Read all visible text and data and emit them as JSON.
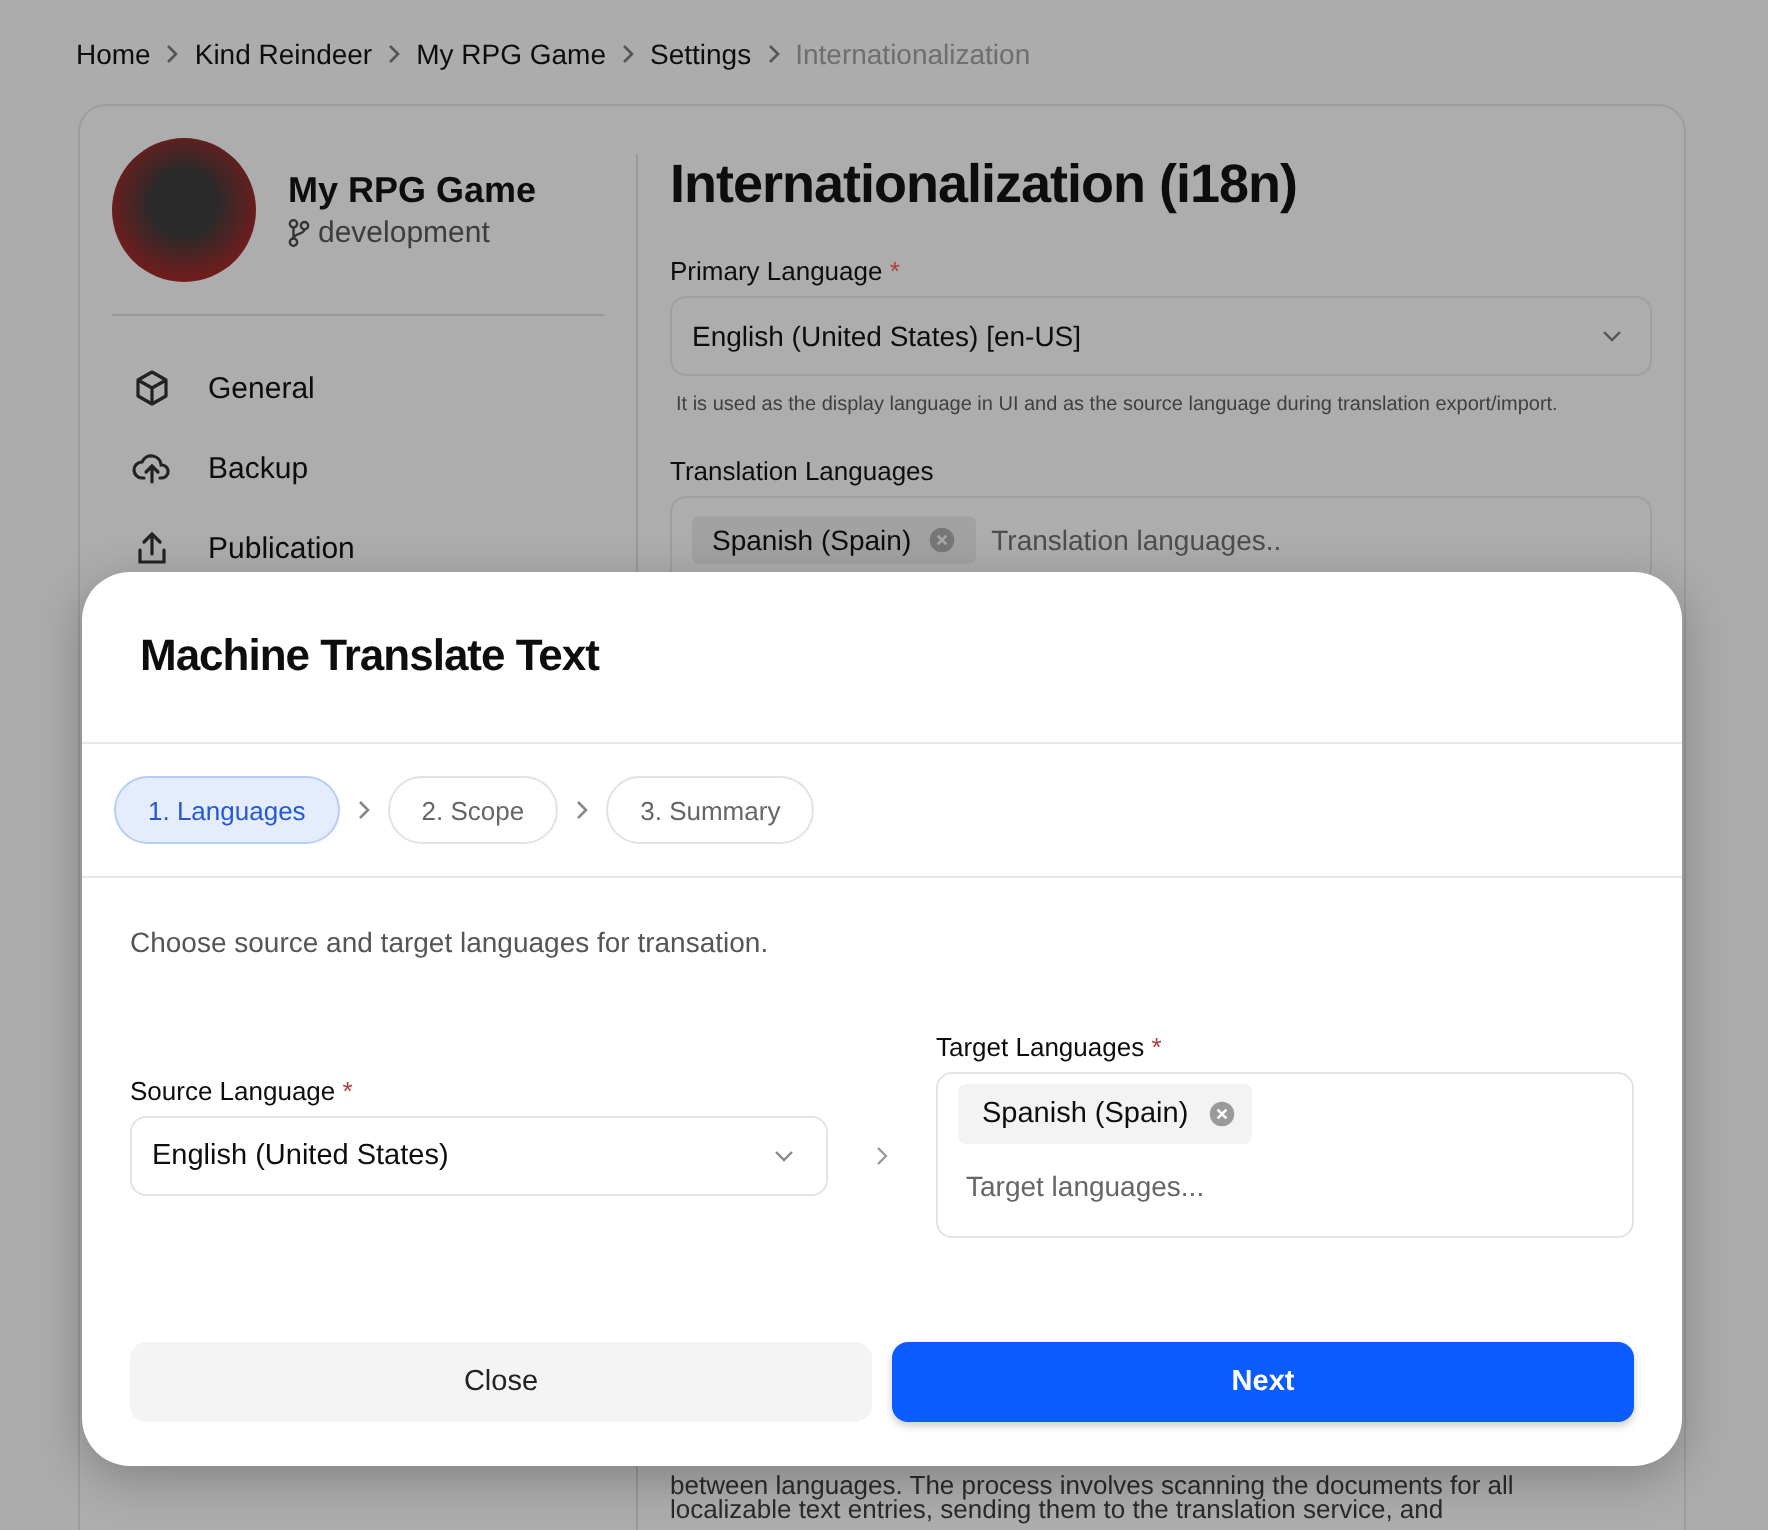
{
  "breadcrumb": [
    {
      "label": "Home",
      "current": false
    },
    {
      "label": "Kind Reindeer",
      "current": false
    },
    {
      "label": "My RPG Game",
      "current": false
    },
    {
      "label": "Settings",
      "current": false
    },
    {
      "label": "Internationalization",
      "current": true
    }
  ],
  "project": {
    "name": "My RPG Game",
    "branch": "development"
  },
  "nav": [
    {
      "label": "General",
      "kind": "cube"
    },
    {
      "label": "Backup",
      "kind": "upload"
    },
    {
      "label": "Publication",
      "kind": "share"
    }
  ],
  "page": {
    "title": "Internationalization (i18n)",
    "primary_language": {
      "label": "Primary Language",
      "required_mark": "*",
      "value": "English (United States) [en-US]",
      "hint": "It is used as the display language in UI and as the source language during translation export/import."
    },
    "translation_languages": {
      "label": "Translation Languages",
      "tags": [
        "Spanish (Spain)"
      ],
      "placeholder": "Translation languages.."
    },
    "description_lines": [
      "between languages. The process involves scanning the documents for all",
      "localizable text entries, sending them to the translation service, and"
    ]
  },
  "dialog": {
    "title": "Machine Translate Text",
    "steps": [
      {
        "label": "1. Languages",
        "selected": true
      },
      {
        "label": "2. Scope",
        "selected": false
      },
      {
        "label": "3. Summary",
        "selected": false
      }
    ],
    "instruction": "Choose source and target languages for transation.",
    "source": {
      "label": "Source Language",
      "required_mark": "*",
      "value": "English (United States)"
    },
    "target": {
      "label": "Target Languages",
      "required_mark": "*",
      "tags": [
        "Spanish (Spain)"
      ],
      "placeholder": "Target languages..."
    },
    "buttons": [
      {
        "label": "Close",
        "kind": "secondary"
      },
      {
        "label": "Next",
        "kind": "primary"
      }
    ]
  }
}
